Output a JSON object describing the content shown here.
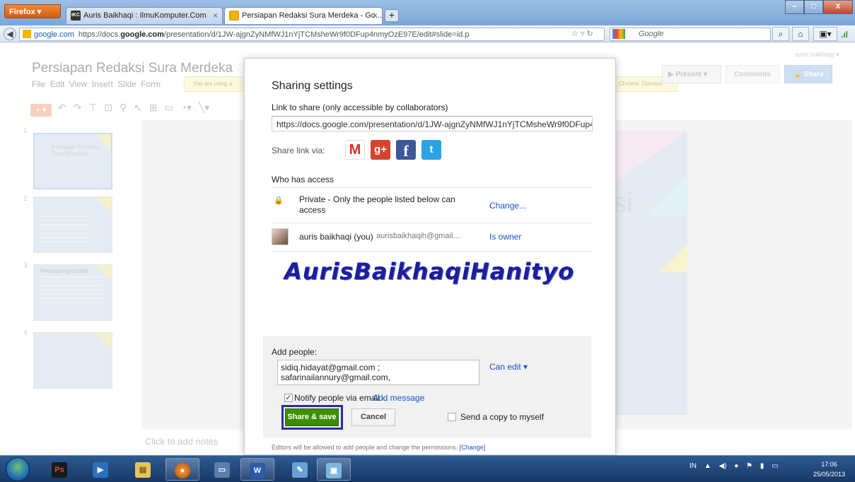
{
  "browser": {
    "app_button": "Firefox",
    "tabs": [
      {
        "label": "Auris Baikhaqi : IlmuKomputer.Com",
        "favicon": "IKC"
      },
      {
        "label": "Persiapan Redaksi Sura Merdeka - Go..."
      }
    ],
    "new_tab": "+",
    "site_identity": "google.com",
    "url_domain_prefix": "https://docs.",
    "url_domain": "google.com",
    "url_path": "/presentation/d/1JW-ajgnZyNMfWJ1nYjTCMsheWr9f0DFup4nmyOzE97E/edit#slide=id.p",
    "search_placeholder": "Google"
  },
  "docs": {
    "title": "Persiapan Redaksi Sura Merdeka",
    "menu": "File  Edit  View  Insert  Slide  Form",
    "user": "auris baikhaqi ▾",
    "notice_left": "You are using a",
    "notice_right": "Chrome. Dismiss",
    "present_label": "Present",
    "comments_label": "Comments",
    "share_label": "Share",
    "notes_placeholder": "Click to add notes",
    "slide_numbers": [
      "1",
      "2",
      "3",
      "4"
    ],
    "slide_fragment": "si",
    "thumb_titles": [
      "Persiapan Redaksi Sura Merdeka",
      "",
      "Persiapan produksi",
      ""
    ]
  },
  "dialog": {
    "title": "Sharing settings",
    "link_label": "Link to share (only accessible by collaborators)",
    "link_value": "https://docs.google.com/presentation/d/1JW-ajgnZyNMfWJ1nYjTCMsheWr9f0DFup4r",
    "share_via_label": "Share link via:",
    "who_has_access": "Who has access",
    "private_text": "Private - Only the people listed below can access",
    "change_link": "Change...",
    "owner_name": "auris baikhaqi (you)",
    "owner_email": "aurisbaikhaqih@gmail....",
    "owner_role": "Is owner",
    "watermark": "AurisBaikhaqiHanityo",
    "add_people_label": "Add people:",
    "people_line1": "sidiq.hidayat@gmail.com ;",
    "people_line2": "safarinailannury@gmail.com,",
    "permission": "Can edit ▾",
    "notify_label": "Notify people via email -",
    "add_message": "Add message",
    "share_save": "Share & save",
    "cancel": "Cancel",
    "send_copy": "Send a copy to myself",
    "footnote": "Editors will be allowed to add people and change the permissions.",
    "footnote_link": "[Change]"
  },
  "taskbar": {
    "lang": "IN",
    "time": "17:06",
    "date": "25/05/2013"
  },
  "colors": {
    "share_save_bg": "#3d9400",
    "link_blue": "#1155cc",
    "watermark": "#1b1f9c"
  }
}
